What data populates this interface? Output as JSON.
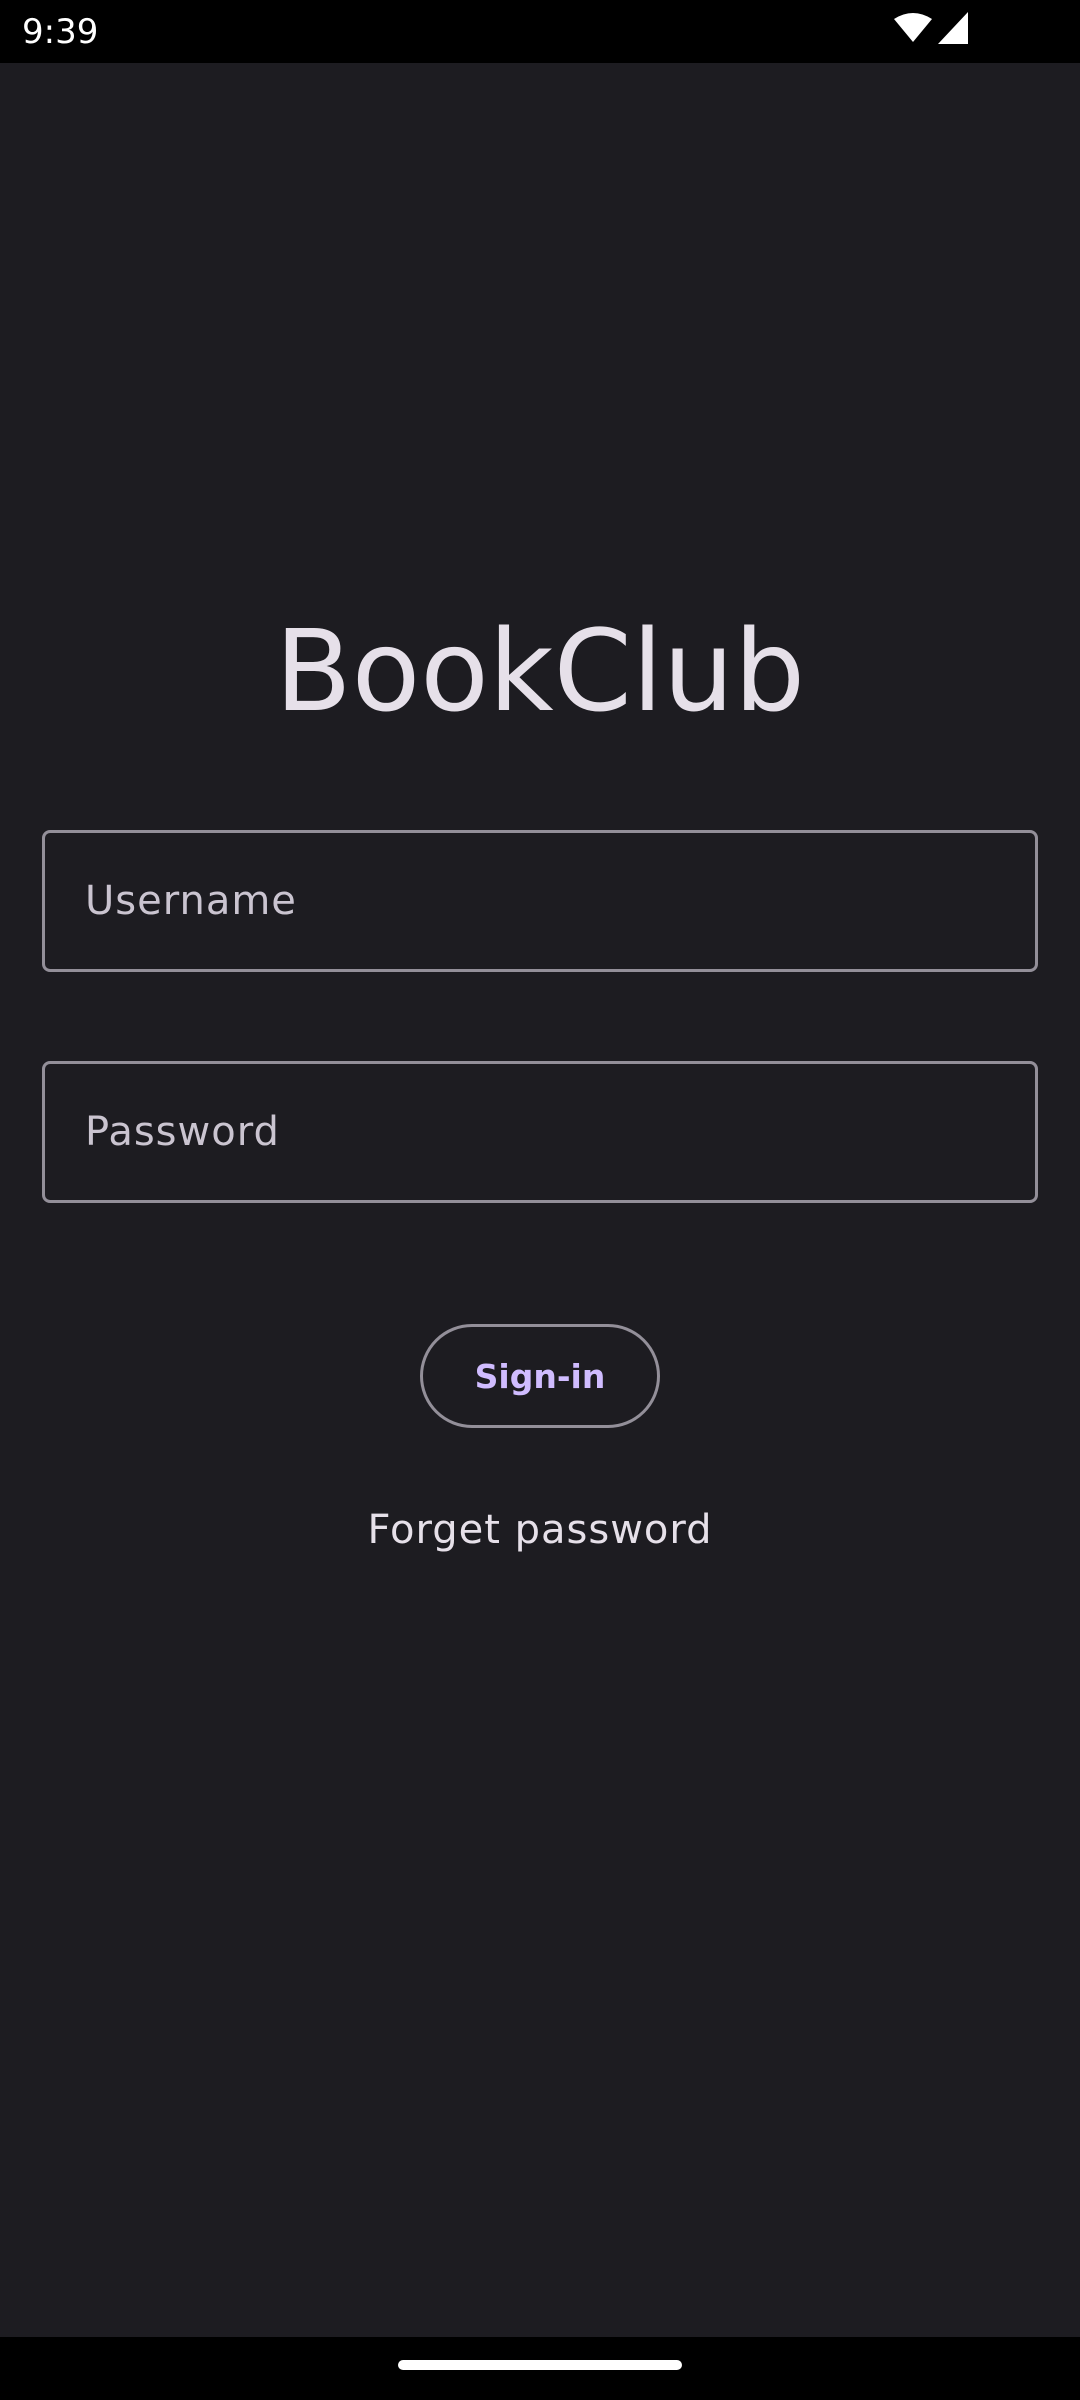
{
  "status_bar": {
    "time": "9:39",
    "icons": [
      "wifi-icon",
      "cellular-signal-icon"
    ]
  },
  "app": {
    "title": "BookClub"
  },
  "login_form": {
    "username_placeholder": "Username",
    "password_placeholder": "Password",
    "signin_label": "Sign-in",
    "forget_password_label": "Forget password"
  },
  "colors": {
    "background": "#1d1c21",
    "accent": "#d0bcff",
    "outline": "#938f99",
    "text": "#e6e0e9"
  }
}
